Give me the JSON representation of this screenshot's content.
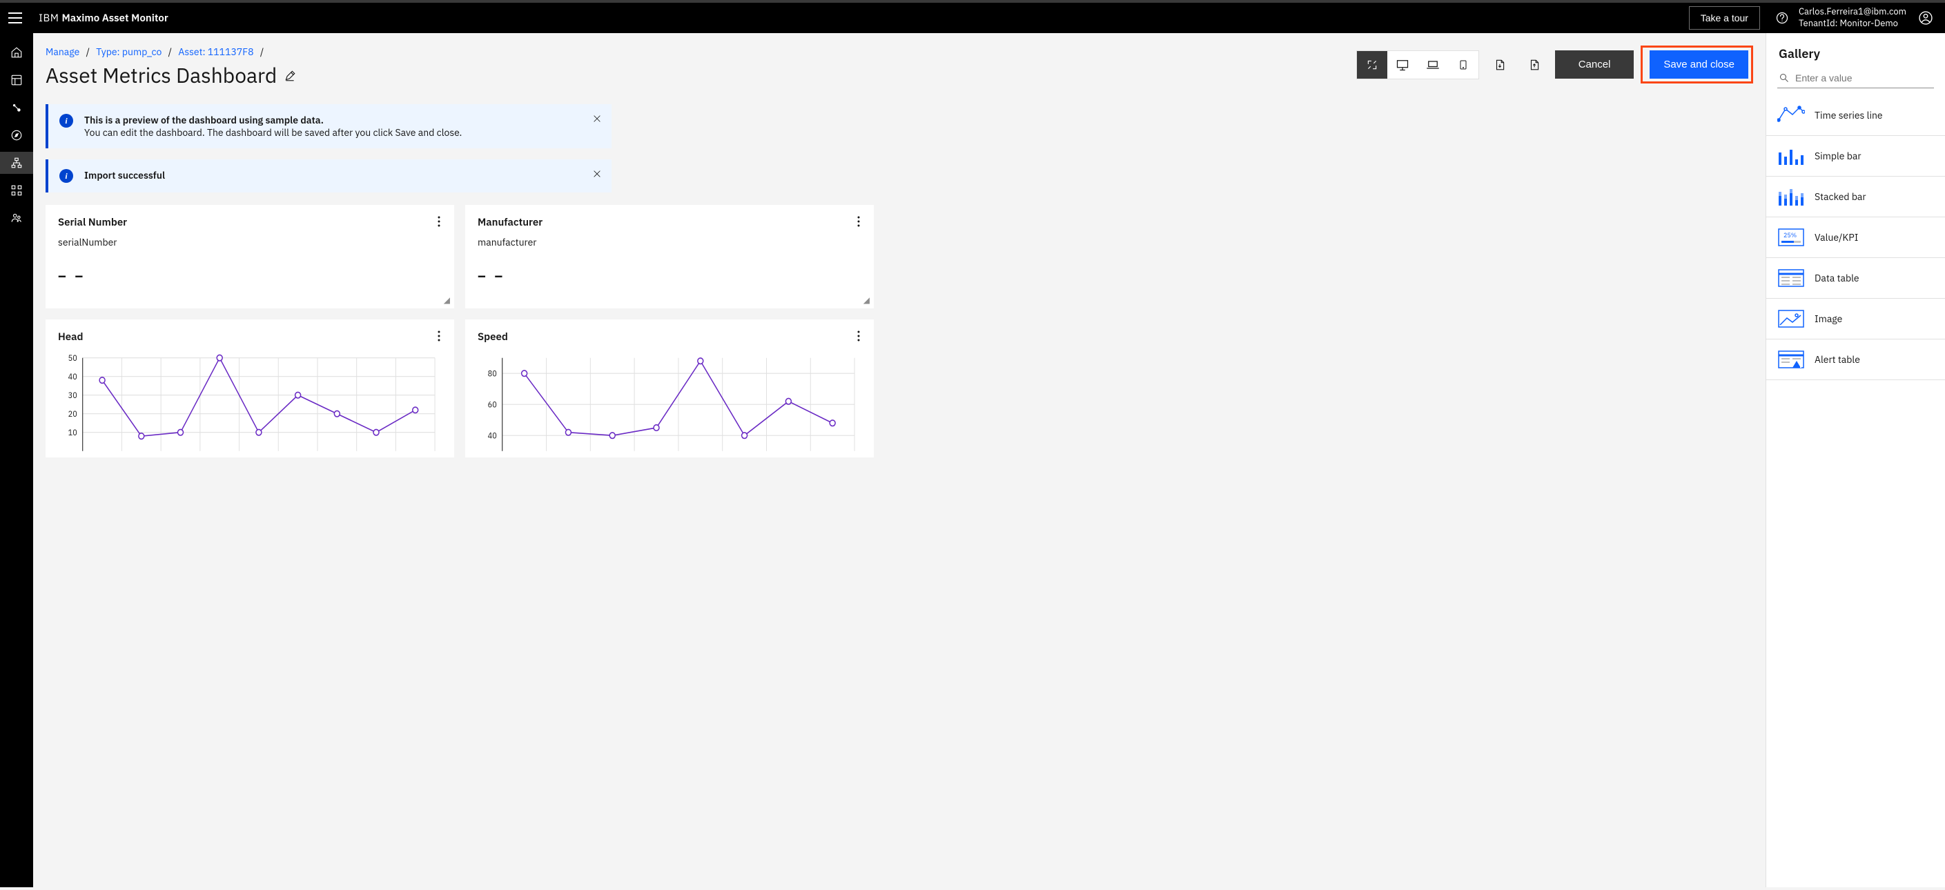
{
  "header": {
    "brand_ibm": "IBM",
    "brand_product": "Maximo Asset Monitor",
    "tour_label": "Take a tour",
    "user_email": "Carlos.Ferreira1@ibm.com",
    "tenant_line": "TenantId: Monitor-Demo"
  },
  "breadcrumbs": {
    "items": [
      "Manage",
      "Type: pump_co",
      "Asset: 111137F8"
    ]
  },
  "page": {
    "title": "Asset Metrics Dashboard",
    "cancel_label": "Cancel",
    "save_label": "Save and close"
  },
  "notices": {
    "preview_title": "This is a preview of the dashboard using sample data.",
    "preview_body": "You can edit the dashboard. The dashboard will be saved after you click Save and close.",
    "import_title": "Import successful"
  },
  "cards": {
    "serial": {
      "title": "Serial Number",
      "sub": "serialNumber",
      "value": "– –"
    },
    "manufacturer": {
      "title": "Manufacturer",
      "sub": "manufacturer",
      "value": "– –"
    },
    "head": {
      "title": "Head"
    },
    "speed": {
      "title": "Speed"
    }
  },
  "gallery": {
    "title": "Gallery",
    "search_placeholder": "Enter a value",
    "items": [
      {
        "label": "Time series line"
      },
      {
        "label": "Simple bar"
      },
      {
        "label": "Stacked bar"
      },
      {
        "label": "Value/KPI"
      },
      {
        "label": "Data table"
      },
      {
        "label": "Image"
      },
      {
        "label": "Alert table"
      }
    ]
  },
  "chart_data": [
    {
      "type": "line",
      "title": "Head",
      "ylim": [
        0,
        50
      ],
      "yticks": [
        10,
        20,
        30,
        40,
        50
      ],
      "series": [
        {
          "name": "Head",
          "values": [
            38,
            8,
            10,
            50,
            10,
            30,
            20,
            10,
            22
          ]
        }
      ]
    },
    {
      "type": "line",
      "title": "Speed",
      "ylim": [
        30,
        90
      ],
      "yticks": [
        40,
        60,
        80
      ],
      "series": [
        {
          "name": "Speed",
          "values": [
            80,
            42,
            40,
            45,
            88,
            40,
            62,
            48
          ]
        }
      ]
    }
  ]
}
